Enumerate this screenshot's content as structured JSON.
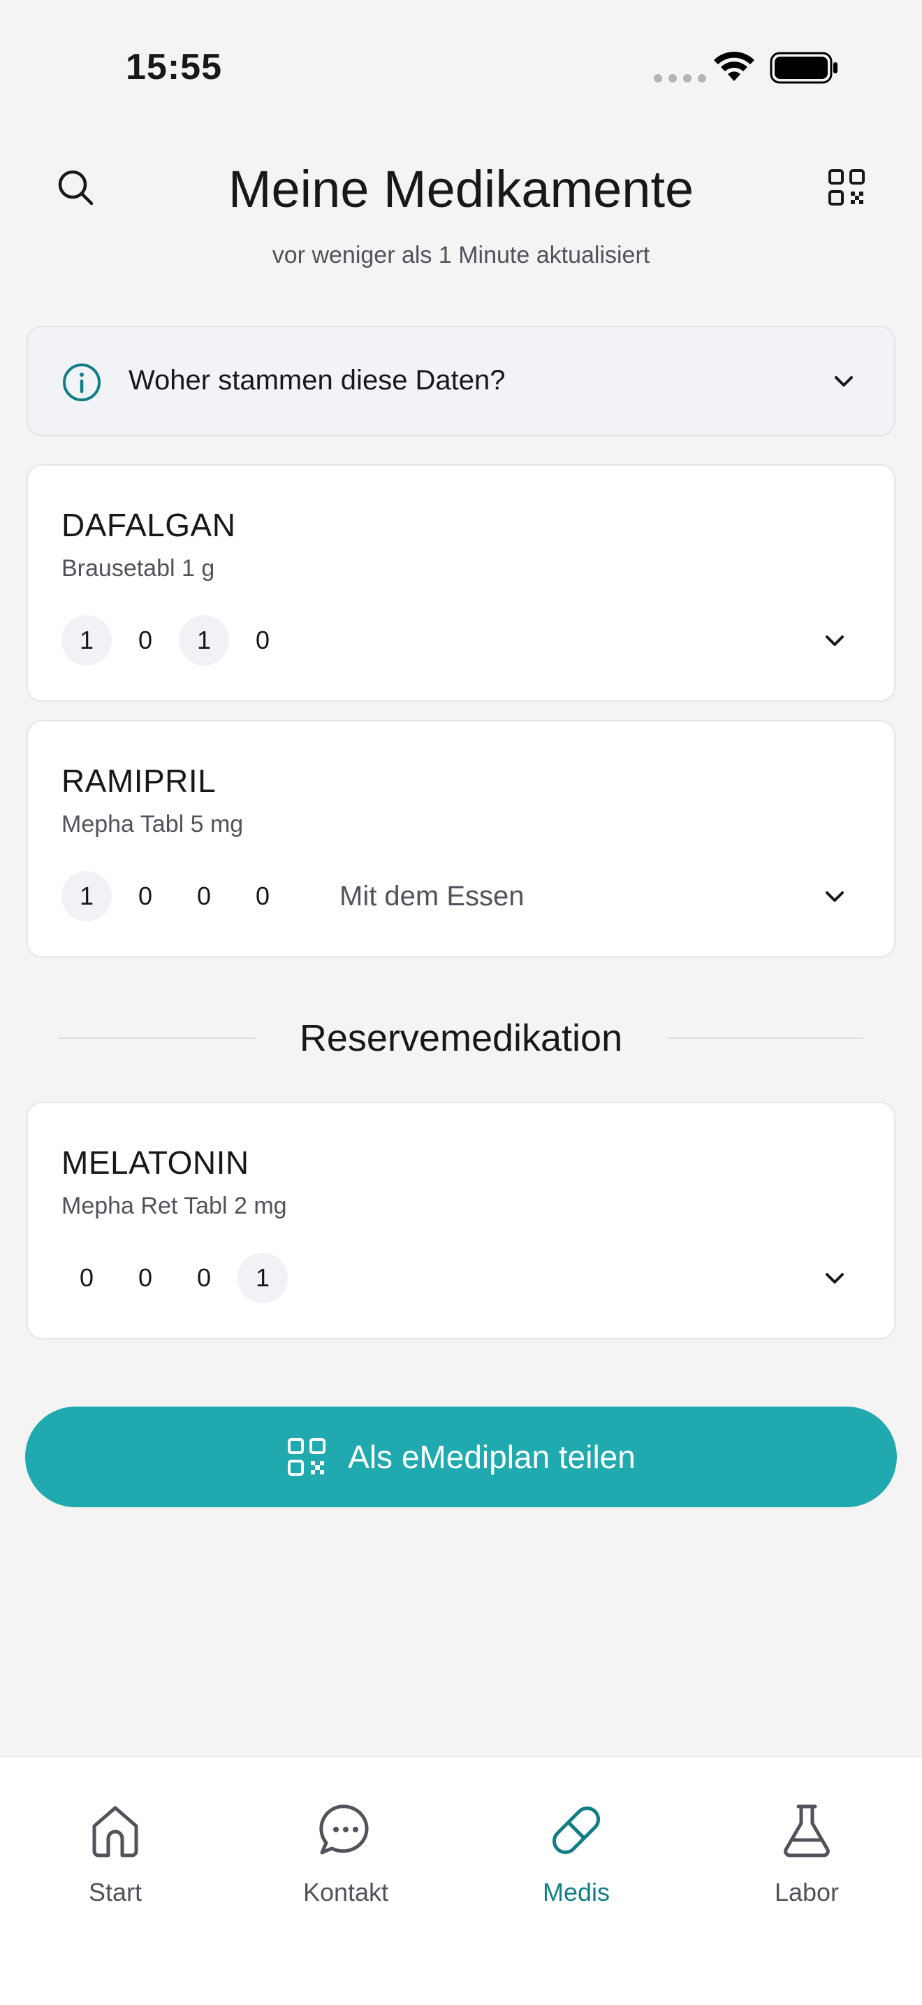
{
  "status_bar": {
    "time": "15:55"
  },
  "header": {
    "title": "Meine Medikamente",
    "subtitle": "vor weniger als 1 Minute aktualisiert",
    "left_icon": "search-icon",
    "right_icon": "qr-code-icon"
  },
  "info_panel": {
    "text": "Woher stammen diese Daten?",
    "icon": "info-icon"
  },
  "medications": [
    {
      "name": "DAFALGAN",
      "description": "Brausetabl 1 g",
      "doses": [
        "1",
        "0",
        "1",
        "0"
      ],
      "note": ""
    },
    {
      "name": "RAMIPRIL",
      "description": "Mepha Tabl 5 mg",
      "doses": [
        "1",
        "0",
        "0",
        "0"
      ],
      "note": "Mit dem Essen"
    }
  ],
  "reserve_section": {
    "title": "Reservemedikation",
    "medications": [
      {
        "name": "MELATONIN",
        "description": "Mepha Ret Tabl 2 mg",
        "doses": [
          "0",
          "0",
          "0",
          "1"
        ],
        "note": ""
      }
    ]
  },
  "share_button": {
    "label": "Als eMediplan teilen",
    "icon": "qr-code-icon"
  },
  "tab_bar": {
    "tabs": [
      {
        "label": "Start",
        "icon": "home-icon",
        "active": false
      },
      {
        "label": "Kontakt",
        "icon": "chat-icon",
        "active": false
      },
      {
        "label": "Medis",
        "icon": "pill-icon",
        "active": true
      },
      {
        "label": "Labor",
        "icon": "flask-icon",
        "active": false
      }
    ]
  },
  "colors": {
    "accent": "#20a9ae",
    "accent_text": "#137d86",
    "background": "#f4f4f5"
  }
}
